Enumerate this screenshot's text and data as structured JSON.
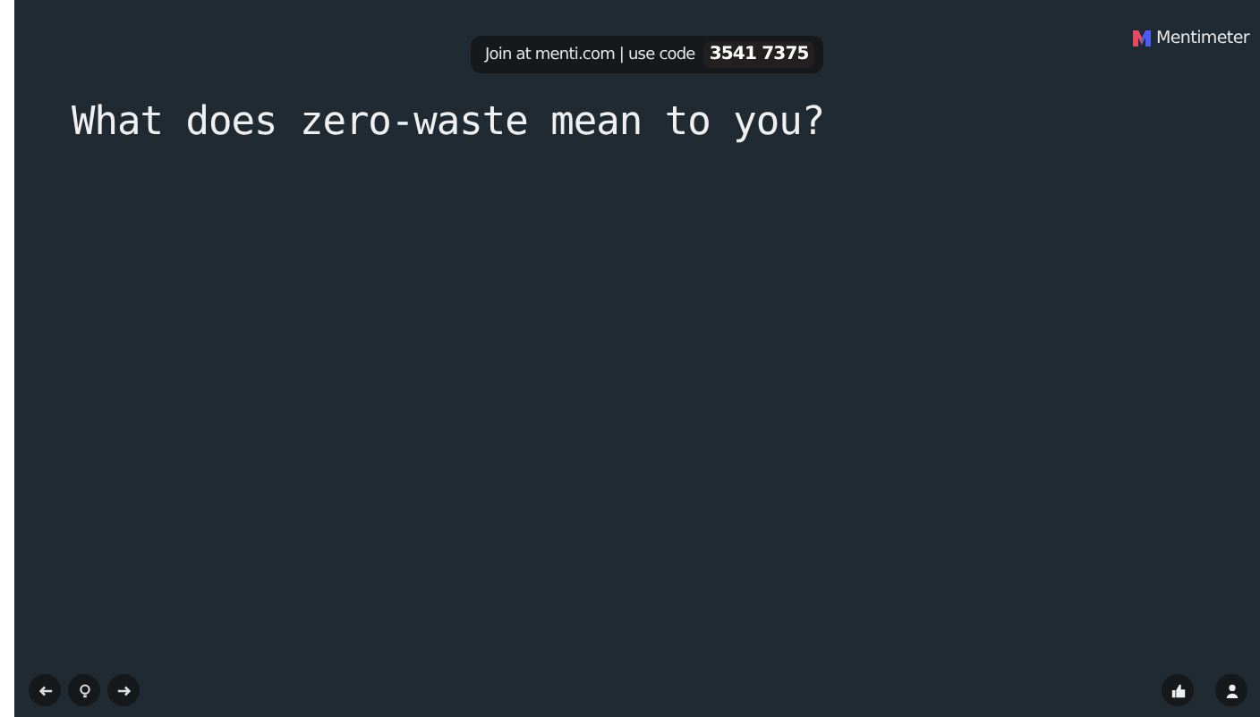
{
  "join_banner": {
    "text": "Join at menti.com | use code",
    "code": "3541 7375"
  },
  "brand": {
    "name": "Mentimeter"
  },
  "question": {
    "text": "What does zero-waste mean to you?"
  },
  "controls_left": [
    {
      "kind": "back"
    },
    {
      "kind": "hint"
    },
    {
      "kind": "next"
    }
  ],
  "controls_right": [
    {
      "kind": "like"
    },
    {
      "kind": "person"
    }
  ]
}
